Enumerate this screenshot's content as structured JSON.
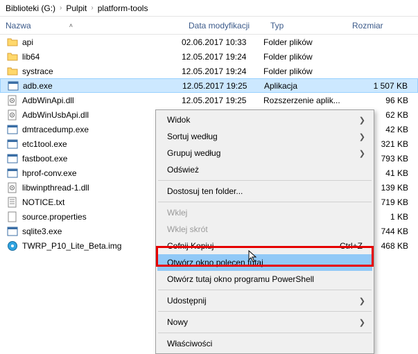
{
  "breadcrumb": {
    "seg1": "Biblioteki (G:)",
    "seg2": "Pulpit",
    "seg3": "platform-tools"
  },
  "header": {
    "name": "Nazwa",
    "date": "Data modyfikacji",
    "type": "Typ",
    "size": "Rozmiar"
  },
  "files": [
    {
      "icon": "folder",
      "name": "api",
      "date": "02.06.2017 10:33",
      "type": "Folder plików",
      "size": ""
    },
    {
      "icon": "folder",
      "name": "lib64",
      "date": "12.05.2017 19:24",
      "type": "Folder plików",
      "size": ""
    },
    {
      "icon": "folder",
      "name": "systrace",
      "date": "12.05.2017 19:24",
      "type": "Folder plików",
      "size": ""
    },
    {
      "icon": "exe",
      "name": "adb.exe",
      "date": "12.05.2017 19:25",
      "type": "Aplikacja",
      "size": "1 507 KB",
      "selected": true
    },
    {
      "icon": "dll",
      "name": "AdbWinApi.dll",
      "date": "12.05.2017 19:25",
      "type": "Rozszerzenie aplik...",
      "size": "96 KB"
    },
    {
      "icon": "dll",
      "name": "AdbWinUsbApi.dll",
      "date": "",
      "type": "",
      "size": "62 KB"
    },
    {
      "icon": "exe",
      "name": "dmtracedump.exe",
      "date": "",
      "type": "",
      "size": "42 KB"
    },
    {
      "icon": "exe",
      "name": "etc1tool.exe",
      "date": "",
      "type": "",
      "size": "321 KB"
    },
    {
      "icon": "exe",
      "name": "fastboot.exe",
      "date": "",
      "type": "",
      "size": "793 KB"
    },
    {
      "icon": "exe",
      "name": "hprof-conv.exe",
      "date": "",
      "type": "",
      "size": "41 KB"
    },
    {
      "icon": "dll",
      "name": "libwinpthread-1.dll",
      "date": "",
      "type": "",
      "size": "139 KB"
    },
    {
      "icon": "txt",
      "name": "NOTICE.txt",
      "date": "",
      "type": "",
      "size": "719 KB"
    },
    {
      "icon": "file",
      "name": "source.properties",
      "date": "",
      "type": "",
      "size": "1 KB"
    },
    {
      "icon": "exe",
      "name": "sqlite3.exe",
      "date": "",
      "type": "",
      "size": "744 KB"
    },
    {
      "icon": "disc",
      "name": "TWRP_P10_Lite_Beta.img",
      "date": "",
      "type": "",
      "size": "468 KB"
    }
  ],
  "menu": {
    "view": "Widok",
    "sortby": "Sortuj według",
    "groupby": "Grupuj według",
    "refresh": "Odśwież",
    "customize": "Dostosuj ten folder...",
    "paste": "Wklej",
    "pasteshortcut": "Wklej skrót",
    "undocopy": "Cofnij Kopiuj",
    "undocopy_sc": "Ctrl+Z",
    "opencmd": "Otwórz okno polecen   tutaj",
    "powershell": "Otwórz tutaj okno programu PowerShell",
    "share": "Udostępnij",
    "new": "Nowy",
    "properties": "Właściwości"
  }
}
